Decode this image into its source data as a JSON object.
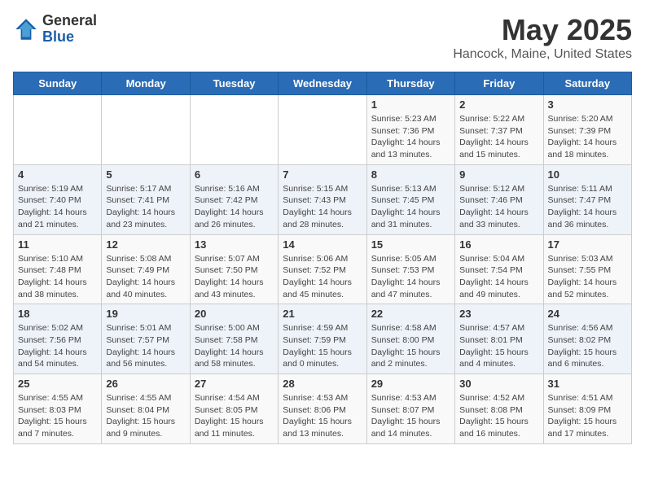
{
  "header": {
    "logo_general": "General",
    "logo_blue": "Blue",
    "title": "May 2025",
    "subtitle": "Hancock, Maine, United States"
  },
  "days_of_week": [
    "Sunday",
    "Monday",
    "Tuesday",
    "Wednesday",
    "Thursday",
    "Friday",
    "Saturday"
  ],
  "weeks": [
    [
      {
        "day": "",
        "info": ""
      },
      {
        "day": "",
        "info": ""
      },
      {
        "day": "",
        "info": ""
      },
      {
        "day": "",
        "info": ""
      },
      {
        "day": "1",
        "info": "Sunrise: 5:23 AM\nSunset: 7:36 PM\nDaylight: 14 hours\nand 13 minutes."
      },
      {
        "day": "2",
        "info": "Sunrise: 5:22 AM\nSunset: 7:37 PM\nDaylight: 14 hours\nand 15 minutes."
      },
      {
        "day": "3",
        "info": "Sunrise: 5:20 AM\nSunset: 7:39 PM\nDaylight: 14 hours\nand 18 minutes."
      }
    ],
    [
      {
        "day": "4",
        "info": "Sunrise: 5:19 AM\nSunset: 7:40 PM\nDaylight: 14 hours\nand 21 minutes."
      },
      {
        "day": "5",
        "info": "Sunrise: 5:17 AM\nSunset: 7:41 PM\nDaylight: 14 hours\nand 23 minutes."
      },
      {
        "day": "6",
        "info": "Sunrise: 5:16 AM\nSunset: 7:42 PM\nDaylight: 14 hours\nand 26 minutes."
      },
      {
        "day": "7",
        "info": "Sunrise: 5:15 AM\nSunset: 7:43 PM\nDaylight: 14 hours\nand 28 minutes."
      },
      {
        "day": "8",
        "info": "Sunrise: 5:13 AM\nSunset: 7:45 PM\nDaylight: 14 hours\nand 31 minutes."
      },
      {
        "day": "9",
        "info": "Sunrise: 5:12 AM\nSunset: 7:46 PM\nDaylight: 14 hours\nand 33 minutes."
      },
      {
        "day": "10",
        "info": "Sunrise: 5:11 AM\nSunset: 7:47 PM\nDaylight: 14 hours\nand 36 minutes."
      }
    ],
    [
      {
        "day": "11",
        "info": "Sunrise: 5:10 AM\nSunset: 7:48 PM\nDaylight: 14 hours\nand 38 minutes."
      },
      {
        "day": "12",
        "info": "Sunrise: 5:08 AM\nSunset: 7:49 PM\nDaylight: 14 hours\nand 40 minutes."
      },
      {
        "day": "13",
        "info": "Sunrise: 5:07 AM\nSunset: 7:50 PM\nDaylight: 14 hours\nand 43 minutes."
      },
      {
        "day": "14",
        "info": "Sunrise: 5:06 AM\nSunset: 7:52 PM\nDaylight: 14 hours\nand 45 minutes."
      },
      {
        "day": "15",
        "info": "Sunrise: 5:05 AM\nSunset: 7:53 PM\nDaylight: 14 hours\nand 47 minutes."
      },
      {
        "day": "16",
        "info": "Sunrise: 5:04 AM\nSunset: 7:54 PM\nDaylight: 14 hours\nand 49 minutes."
      },
      {
        "day": "17",
        "info": "Sunrise: 5:03 AM\nSunset: 7:55 PM\nDaylight: 14 hours\nand 52 minutes."
      }
    ],
    [
      {
        "day": "18",
        "info": "Sunrise: 5:02 AM\nSunset: 7:56 PM\nDaylight: 14 hours\nand 54 minutes."
      },
      {
        "day": "19",
        "info": "Sunrise: 5:01 AM\nSunset: 7:57 PM\nDaylight: 14 hours\nand 56 minutes."
      },
      {
        "day": "20",
        "info": "Sunrise: 5:00 AM\nSunset: 7:58 PM\nDaylight: 14 hours\nand 58 minutes."
      },
      {
        "day": "21",
        "info": "Sunrise: 4:59 AM\nSunset: 7:59 PM\nDaylight: 15 hours\nand 0 minutes."
      },
      {
        "day": "22",
        "info": "Sunrise: 4:58 AM\nSunset: 8:00 PM\nDaylight: 15 hours\nand 2 minutes."
      },
      {
        "day": "23",
        "info": "Sunrise: 4:57 AM\nSunset: 8:01 PM\nDaylight: 15 hours\nand 4 minutes."
      },
      {
        "day": "24",
        "info": "Sunrise: 4:56 AM\nSunset: 8:02 PM\nDaylight: 15 hours\nand 6 minutes."
      }
    ],
    [
      {
        "day": "25",
        "info": "Sunrise: 4:55 AM\nSunset: 8:03 PM\nDaylight: 15 hours\nand 7 minutes."
      },
      {
        "day": "26",
        "info": "Sunrise: 4:55 AM\nSunset: 8:04 PM\nDaylight: 15 hours\nand 9 minutes."
      },
      {
        "day": "27",
        "info": "Sunrise: 4:54 AM\nSunset: 8:05 PM\nDaylight: 15 hours\nand 11 minutes."
      },
      {
        "day": "28",
        "info": "Sunrise: 4:53 AM\nSunset: 8:06 PM\nDaylight: 15 hours\nand 13 minutes."
      },
      {
        "day": "29",
        "info": "Sunrise: 4:53 AM\nSunset: 8:07 PM\nDaylight: 15 hours\nand 14 minutes."
      },
      {
        "day": "30",
        "info": "Sunrise: 4:52 AM\nSunset: 8:08 PM\nDaylight: 15 hours\nand 16 minutes."
      },
      {
        "day": "31",
        "info": "Sunrise: 4:51 AM\nSunset: 8:09 PM\nDaylight: 15 hours\nand 17 minutes."
      }
    ]
  ]
}
